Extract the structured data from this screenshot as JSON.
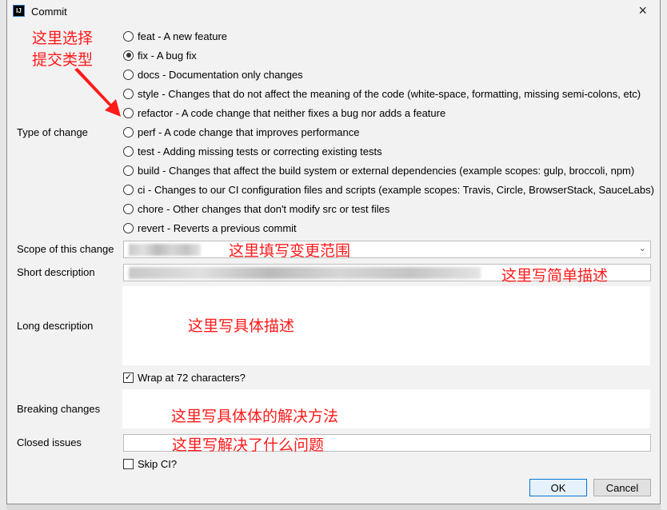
{
  "window": {
    "title": "Commit",
    "logo": "IJ",
    "close": "×"
  },
  "annotations": {
    "type_hint_1": "这里选择",
    "type_hint_2": "提交类型",
    "scope_hint": "这里填写变更范围",
    "short_hint": "这里写简单描述",
    "long_hint": "这里写具体描述",
    "breaking_hint": "这里写具体体的解决方法",
    "closed_hint": "这里写解决了什么问题",
    "color": "#ff1a1a"
  },
  "labels": {
    "type": "Type of change",
    "scope": "Scope of this change",
    "short": "Short description",
    "long": "Long description",
    "breaking": "Breaking changes",
    "closed": "Closed issues"
  },
  "types": [
    {
      "label": "feat - A new feature",
      "selected": false
    },
    {
      "label": "fix - A bug fix",
      "selected": true
    },
    {
      "label": "docs - Documentation only changes",
      "selected": false
    },
    {
      "label": "style - Changes that do not affect the meaning of the code (white-space, formatting, missing semi-colons, etc)",
      "selected": false
    },
    {
      "label": "refactor - A code change that neither fixes a bug nor adds a feature",
      "selected": false
    },
    {
      "label": "perf - A code change that improves performance",
      "selected": false
    },
    {
      "label": "test - Adding missing tests or correcting existing tests",
      "selected": false
    },
    {
      "label": "build - Changes that affect the build system or external dependencies (example scopes: gulp, broccoli, npm)",
      "selected": false
    },
    {
      "label": "ci - Changes to our CI configuration files and scripts (example scopes: Travis, Circle, BrowserStack, SauceLabs)",
      "selected": false
    },
    {
      "label": "chore - Other changes that don't modify src or test files",
      "selected": false
    },
    {
      "label": "revert - Reverts a previous commit",
      "selected": false
    }
  ],
  "wrap": {
    "label": "Wrap at 72 characters?",
    "checked": true
  },
  "skip_ci": {
    "label": "Skip CI?",
    "checked": false
  },
  "buttons": {
    "ok": "OK",
    "cancel": "Cancel"
  }
}
